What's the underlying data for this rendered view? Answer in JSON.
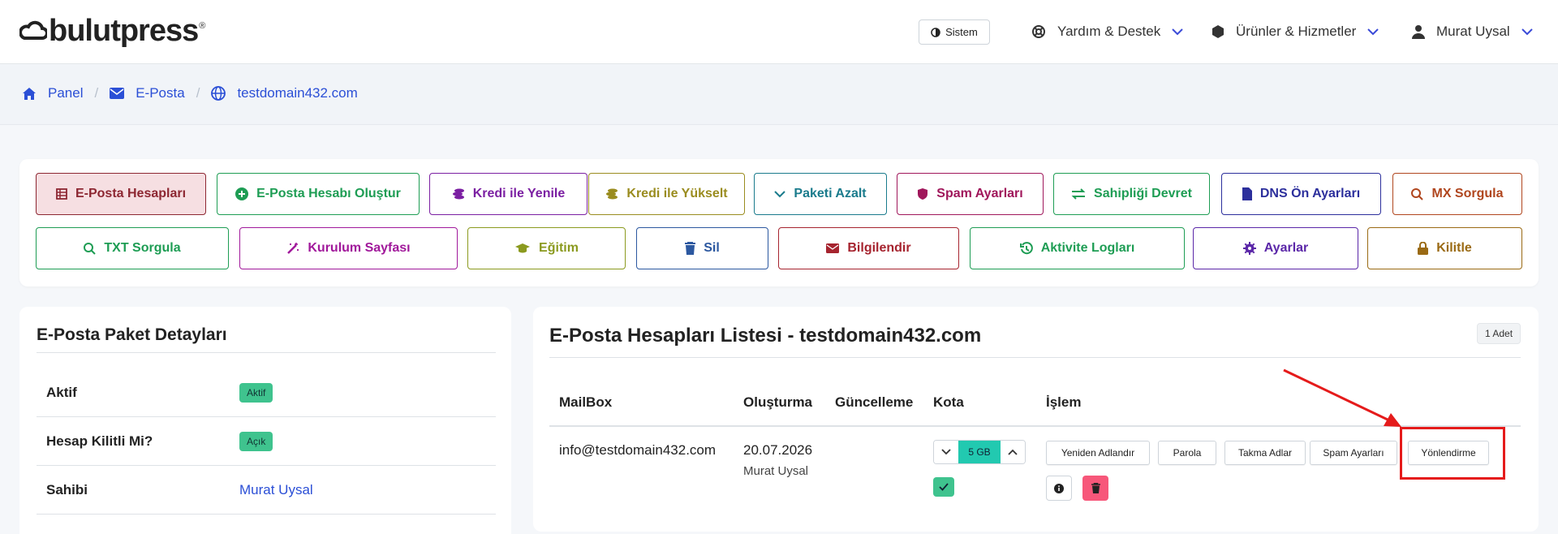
{
  "header": {
    "logo_text": "bulutpress",
    "theme_button": "Sistem",
    "nav": {
      "help": "Yardım & Destek",
      "products": "Ürünler & Hizmetler",
      "user": "Murat Uysal"
    }
  },
  "breadcrumb": [
    "Panel",
    "E-Posta",
    "testdomain432.com"
  ],
  "actions_row1": [
    "E-Posta Hesapları",
    "E-Posta Hesabı Oluştur",
    "Kredi ile Yenile",
    "Kredi ile Yükselt",
    "Paketi Azalt",
    "Spam Ayarları",
    "Sahipliği Devret",
    "DNS Ön Ayarları",
    "MX Sorgula"
  ],
  "actions_row2": [
    "TXT Sorgula",
    "Kurulum Sayfası",
    "Eğitim",
    "Sil",
    "Bilgilendir",
    "Aktivite Logları",
    "Ayarlar",
    "Kilitle"
  ],
  "package_details": {
    "title": "E-Posta Paket Detayları",
    "rows": [
      {
        "label": "Aktif",
        "value": "Aktif"
      },
      {
        "label": "Hesap Kilitli Mi?",
        "value": "Açık"
      },
      {
        "label": "Sahibi",
        "value": "Murat Uysal"
      }
    ]
  },
  "accounts_list": {
    "title": "E-Posta Hesapları Listesi - testdomain432.com",
    "count": "1 Adet",
    "columns": [
      "MailBox",
      "Oluşturma",
      "Güncelleme",
      "Kota",
      "İşlem"
    ],
    "rows": [
      {
        "mailbox": "info@testdomain432.com",
        "created_date": "20.07.2026",
        "created_by": "Murat Uysal",
        "updated": "",
        "quota": "5 GB",
        "actions": [
          "Yeniden Adlandır",
          "Parola",
          "Takma Adlar",
          "Spam Ayarları",
          "Yönlendirme"
        ]
      }
    ]
  },
  "colors": {
    "link_blue": "#2b4fd6",
    "highlight_red": "#e51b1b",
    "success_green": "#3fc38e",
    "quota_teal": "#22c9b0",
    "danger_pink": "#f7577a"
  }
}
